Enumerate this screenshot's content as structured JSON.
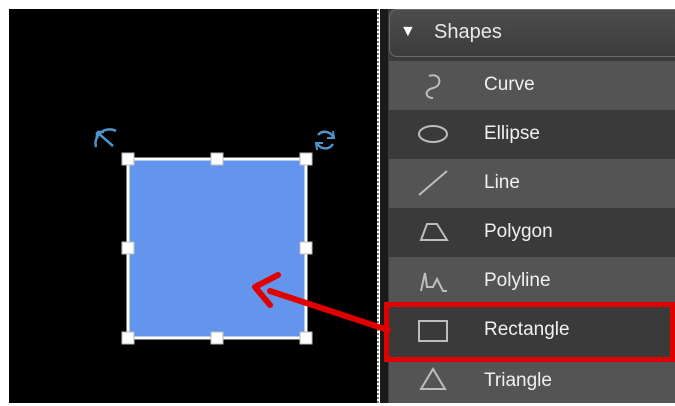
{
  "panel": {
    "header_title": "Shapes",
    "header_icon": "triangle-down-icon",
    "items": [
      {
        "label": "Curve",
        "icon": "curve-icon"
      },
      {
        "label": "Ellipse",
        "icon": "ellipse-icon"
      },
      {
        "label": "Line",
        "icon": "line-icon"
      },
      {
        "label": "Polygon",
        "icon": "polygon-icon"
      },
      {
        "label": "Polyline",
        "icon": "polyline-icon"
      },
      {
        "label": "Rectangle",
        "icon": "rectangle-icon",
        "highlighted": true
      },
      {
        "label": "Triangle",
        "icon": "triangle-icon"
      }
    ]
  },
  "canvas": {
    "shape": "rectangle",
    "fill_color": "#6495ED",
    "selected": true,
    "handles": [
      "rotate-icon",
      "refresh-icon"
    ]
  },
  "annotation": {
    "highlight_color": "#e00000",
    "arrow_color": "#e00000",
    "arrow_from": "Rectangle",
    "arrow_to": "rectangle-shape"
  }
}
